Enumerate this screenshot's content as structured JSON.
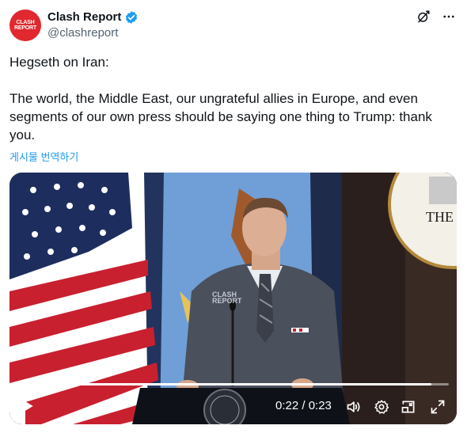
{
  "author": {
    "display_name": "Clash Report",
    "handle": "@clashreport",
    "avatar_text_line1": "CLASH",
    "avatar_text_line2": "REPORT"
  },
  "tweet": {
    "text": "Hegseth on Iran:\n\nThe world, the Middle East, our ungrateful allies in Europe, and even segments of our own press should be saying one thing to Trump: thank you.",
    "translate_label": "게시물 번역하기"
  },
  "video": {
    "time_display": "0:22 / 0:23",
    "progress": 0.96,
    "watermark_line1": "CLASH",
    "watermark_line2": "REPORT",
    "seal_text": "THE"
  },
  "icons": {
    "verified": "verified-badge-icon",
    "grok": "grok-icon",
    "more": "more-icon",
    "play": "play-icon",
    "volume": "volume-icon",
    "settings": "gear-icon",
    "captions": "captions-icon",
    "fullscreen": "fullscreen-icon"
  },
  "colors": {
    "verified": "#1d9bf0",
    "link": "#1d9bf0",
    "avatar_bg": "#e0282e"
  }
}
